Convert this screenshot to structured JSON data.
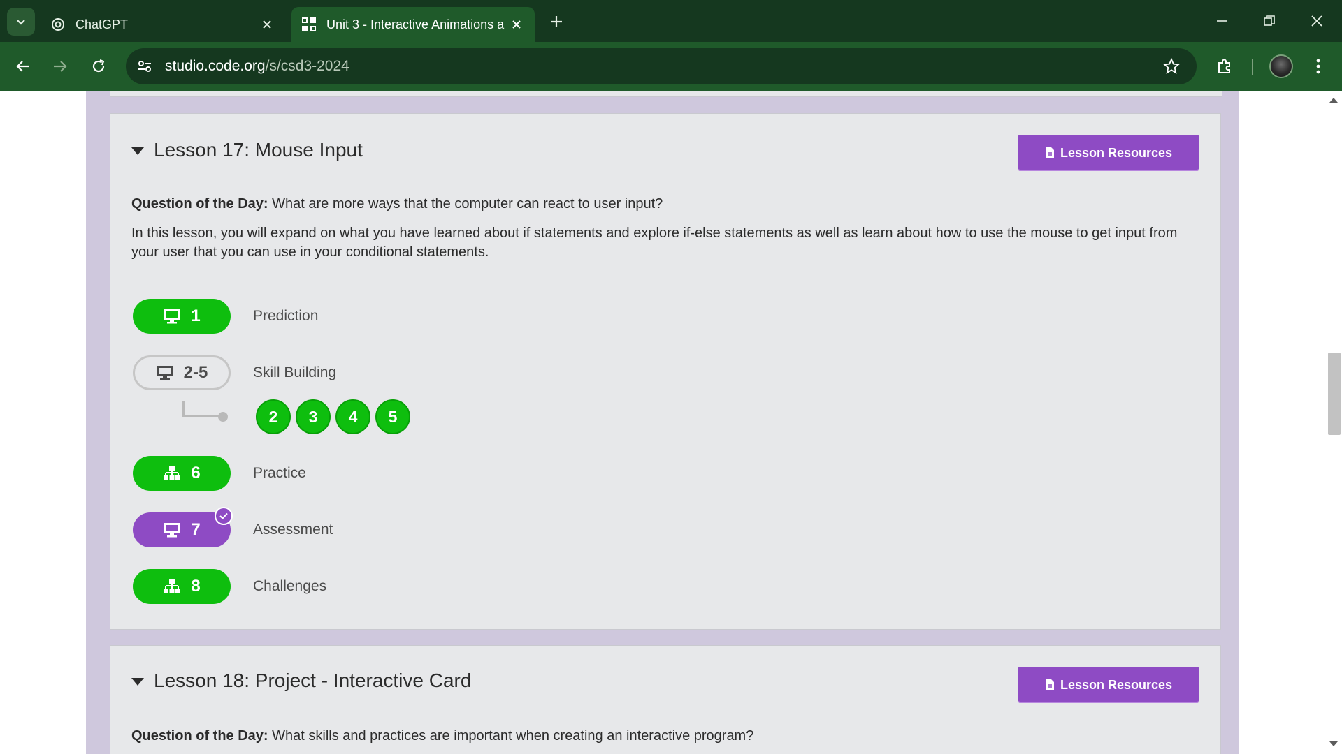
{
  "browser": {
    "tabs": [
      {
        "title": "ChatGPT",
        "active": false,
        "favicon": "openai-icon"
      },
      {
        "title": "Unit 3 - Interactive Animations a",
        "active": true,
        "favicon": "code-org-icon"
      }
    ],
    "url_host": "studio.code.org",
    "url_path": "/s/csd3-2024"
  },
  "lessons": [
    {
      "title": "Lesson 17: Mouse Input",
      "resources_label": "Lesson Resources",
      "qotd_label": "Question of the Day:",
      "qotd_text": " What are more ways that the computer can react to user input?",
      "description": "In this lesson, you will expand on what you have learned about if statements and explore if-else statements as well as learn about how to use the mouse to get input from your user that you can use in your conditional statements.",
      "levels": [
        {
          "number": "1",
          "label": "Prediction",
          "icon": "monitor-icon",
          "status": "completed"
        },
        {
          "number": "2-5",
          "label": "Skill Building",
          "icon": "monitor-icon",
          "status": "not-started",
          "sublevels": [
            "2",
            "3",
            "4",
            "5"
          ]
        },
        {
          "number": "6",
          "label": "Practice",
          "icon": "hierarchy-icon",
          "status": "completed"
        },
        {
          "number": "7",
          "label": "Assessment",
          "icon": "monitor-icon",
          "status": "submitted"
        },
        {
          "number": "8",
          "label": "Challenges",
          "icon": "hierarchy-icon",
          "status": "completed"
        }
      ]
    },
    {
      "title": "Lesson 18: Project - Interactive Card",
      "resources_label": "Lesson Resources",
      "qotd_label": "Question of the Day:",
      "qotd_text": " What skills and practices are important when creating an interactive program?"
    }
  ],
  "colors": {
    "chrome_dark": "#15381f",
    "chrome": "#1f5a2a",
    "completed_green": "#0ebe0e",
    "assessment_purple": "#8e4bc4",
    "page_band": "#cfc8dd"
  }
}
